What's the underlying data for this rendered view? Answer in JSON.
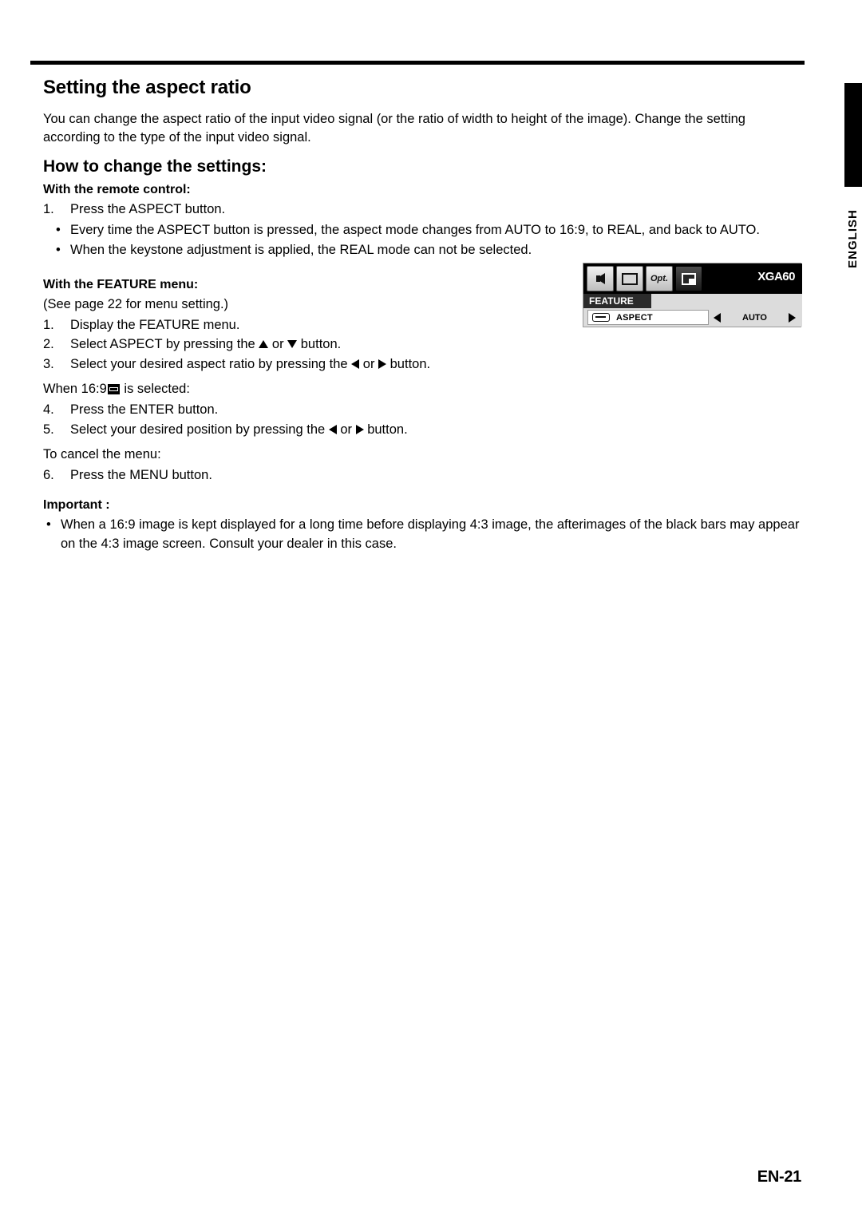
{
  "sidebar": {
    "language_tab": "ENGLISH"
  },
  "document": {
    "title": "Setting the aspect ratio",
    "intro": "You can change the aspect ratio of the input video signal (or the ratio of width to height of the image). Change the setting according to the type of the input video signal.",
    "subtitle": "How to change the settings:",
    "remote_heading": "With the remote control:",
    "remote_steps": [
      {
        "num": "1.",
        "text": "Press the ASPECT button."
      }
    ],
    "remote_bullets": [
      "Every time the ASPECT button is pressed, the aspect mode changes from AUTO to 16:9, to REAL, and back to AUTO.",
      "When the keystone adjustment is applied, the REAL mode can not be selected."
    ],
    "feature_heading": "With the FEATURE menu:",
    "feature_note": "(See page 22 for menu setting.)",
    "feature_steps": [
      {
        "num": "1.",
        "text": "Display the FEATURE menu."
      },
      {
        "num": "2.",
        "text_before": "Select ASPECT by pressing the ",
        "text_mid": " or ",
        "text_after": " button."
      },
      {
        "num": "3.",
        "text_before": "Select your desired aspect ratio by pressing the ",
        "text_mid": " or ",
        "text_after": " button."
      }
    ],
    "when_169_before": "When 16:9",
    "when_169_after": "is selected:",
    "feature_steps2": [
      {
        "num": "4.",
        "text": "Press the ENTER button."
      },
      {
        "num": "5.",
        "text_before": "Select your desired position  by pressing the ",
        "text_mid": " or ",
        "text_after": " button."
      }
    ],
    "cancel_line": "To cancel the menu:",
    "cancel_steps": [
      {
        "num": "6.",
        "text": "Press the MENU button."
      }
    ],
    "important_heading": "Important :",
    "important_bullets": [
      "When a 16:9 image is kept displayed for a long time before displaying 4:3 image, the afterimages of the black bars may appear on the 4:3 image screen. Consult your dealer in this case."
    ],
    "page_number": "EN-21"
  },
  "osd": {
    "icons": [
      {
        "name": "image-audio-icon",
        "label": ""
      },
      {
        "name": "image-icon",
        "label": ""
      },
      {
        "name": "opt-icon",
        "label": "Opt."
      },
      {
        "name": "feature-icon",
        "label": ""
      }
    ],
    "signal": "XGA60",
    "menu_title": "FEATURE",
    "row_label": "ASPECT",
    "row_value": "AUTO"
  }
}
